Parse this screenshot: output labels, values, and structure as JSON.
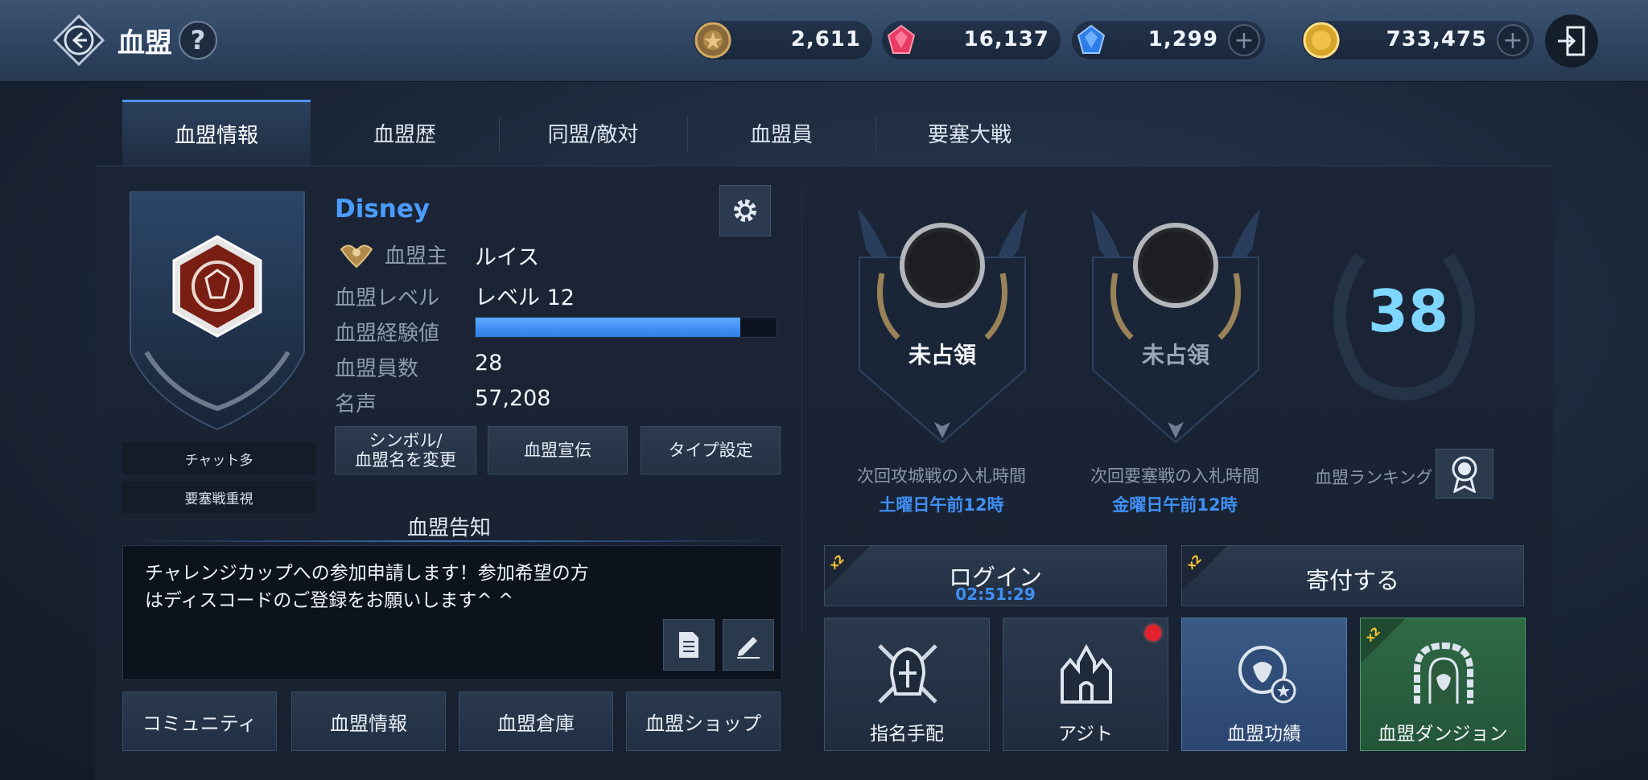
{
  "header": {
    "title": "血盟",
    "help_label": "?",
    "currencies": [
      {
        "icon": "bronze-medal-coin-icon",
        "amount": "2,611"
      },
      {
        "icon": "red-gem-icon",
        "amount": "16,137"
      },
      {
        "icon": "blue-gem-icon",
        "amount": "1,299"
      },
      {
        "icon": "gold-coin-icon",
        "amount": "733,475"
      }
    ],
    "plus_label": "+"
  },
  "tabs": [
    {
      "label": "血盟情報",
      "active": true
    },
    {
      "label": "血盟歴",
      "active": false
    },
    {
      "label": "同盟/敵対",
      "active": false
    },
    {
      "label": "血盟員",
      "active": false
    },
    {
      "label": "要塞大戦",
      "active": false
    }
  ],
  "clan": {
    "name": "Disney",
    "tags": [
      "チャット多",
      "要塞戦重視"
    ],
    "leader_label": "血盟主",
    "leader_value": "ルイス",
    "level_label": "血盟レベル",
    "level_value": "レベル 12",
    "exp_label": "血盟経験値",
    "exp_fraction": 0.88,
    "members_label": "血盟員数",
    "members_value": "28",
    "fame_label": "名声",
    "fame_value": "57,208"
  },
  "actions": {
    "symbol_line1": "シンボル/",
    "symbol_line2": "血盟名を変更",
    "promo": "血盟宣伝",
    "type": "タイプ設定"
  },
  "notice": {
    "title": "血盟告知",
    "line1": "チャレンジカップへの参加申請します！参加希望の方",
    "line2": "はディスコードのご登録をお願いします^ ^"
  },
  "bottom_buttons": [
    "コミュニティ",
    "血盟情報",
    "血盟倉庫",
    "血盟ショップ"
  ],
  "siege": [
    {
      "status": "未占領",
      "bid_label": "次回攻城戦の入札時間",
      "bid_time": "土曜日午前12時"
    },
    {
      "status": "未占領",
      "bid_label": "次回要塞戦の入札時間",
      "bid_time": "金曜日午前12時"
    }
  ],
  "ranking": {
    "value": "38",
    "label": "血盟ランキング"
  },
  "event_buttons": [
    {
      "label": "ログイン",
      "timer": "02:51:29",
      "badge": "x2 EVENT"
    },
    {
      "label": "寄付する",
      "timer": "",
      "badge": "x2 EVENT"
    }
  ],
  "tiles": [
    {
      "label": "指名手配",
      "icon": "helmet-swords-icon"
    },
    {
      "label": "アジト",
      "icon": "castle-icon",
      "notify": true
    },
    {
      "label": "血盟功績",
      "icon": "lion-emblem-icon"
    },
    {
      "label": "血盟ダンジョン",
      "icon": "dungeon-gate-icon",
      "badge": "x2 EVENT"
    }
  ],
  "colors": {
    "accent_blue": "#4b9cff",
    "timer_blue": "#3f8ff5",
    "rank_cyan": "#7fd6ff",
    "green_tile": "#2f6a45",
    "blue_tile": "#3a5a86"
  }
}
